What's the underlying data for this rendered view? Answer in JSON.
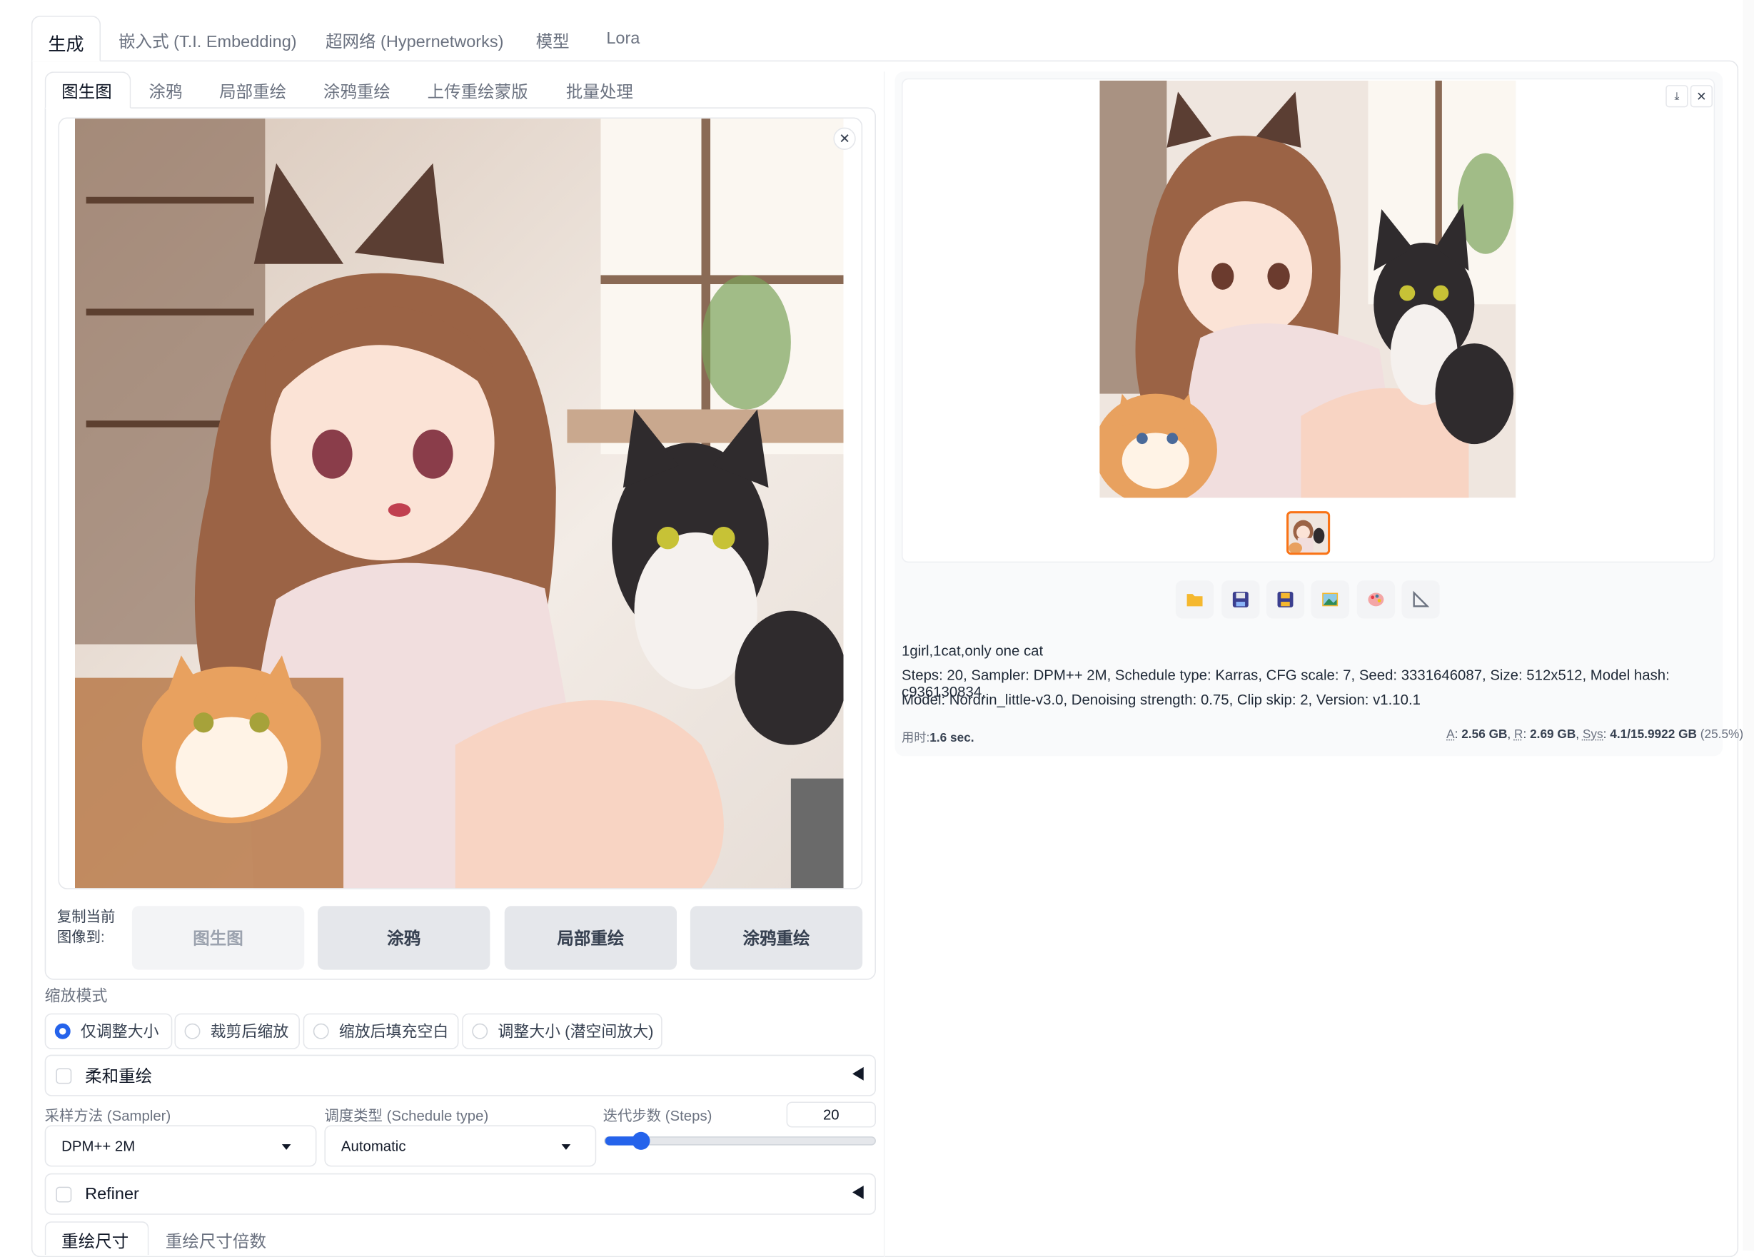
{
  "top_tabs": [
    "生成",
    "嵌入式 (T.I. Embedding)",
    "超网络 (Hypernetworks)",
    "模型",
    "Lora"
  ],
  "sub_tabs": [
    "图生图",
    "涂鸦",
    "局部重绘",
    "涂鸦重绘",
    "上传重绘蒙版",
    "批量处理"
  ],
  "copy_to": {
    "label": "复制当前图像到:",
    "buttons": [
      "图生图",
      "涂鸦",
      "局部重绘",
      "涂鸦重绘"
    ]
  },
  "resize_mode": {
    "label": "缩放模式",
    "options": [
      "仅调整大小",
      "裁剪后缩放",
      "缩放后填充空白",
      "调整大小 (潜空间放大)"
    ],
    "selected": "仅调整大小"
  },
  "soft_inpaint": {
    "label": "柔和重绘",
    "checked": false
  },
  "sampler": {
    "label": "采样方法 (Sampler)",
    "value": "DPM++ 2M"
  },
  "schedule": {
    "label": "调度类型 (Schedule type)",
    "value": "Automatic"
  },
  "steps": {
    "label": "迭代步数 (Steps)",
    "value": "20",
    "fraction": 0.13
  },
  "refiner": {
    "label": "Refiner",
    "checked": false
  },
  "bottom_tabs": [
    "重绘尺寸",
    "重绘尺寸倍数"
  ],
  "output": {
    "prompt": "1girl,1cat,only one cat",
    "params_line1": "Steps: 20, Sampler: DPM++ 2M, Schedule type: Karras, CFG scale: 7, Seed: 3331646087, Size: 512x512, Model hash: c936130834,",
    "params_line2": "Model: Nordrin_little-v3.0, Denoising strength: 0.75, Clip skip: 2, Version: v1.10.1",
    "time_label": "用时:",
    "time_value": "1.6 sec.",
    "vram_a_label": "A",
    "vram_a": "2.56 GB",
    "vram_r_label": "R",
    "vram_r": "2.69 GB",
    "vram_sys_label": "Sys",
    "vram_sys": "4.1/15.9922 GB",
    "vram_pct": "(25.5%)"
  },
  "tool_icons": [
    "folder-icon",
    "save-icon",
    "zip-icon",
    "send-to-img2img-icon",
    "send-to-inpaint-icon",
    "send-to-extras-icon"
  ],
  "colors": {
    "accent": "#2563eb",
    "orange": "#f97316"
  }
}
